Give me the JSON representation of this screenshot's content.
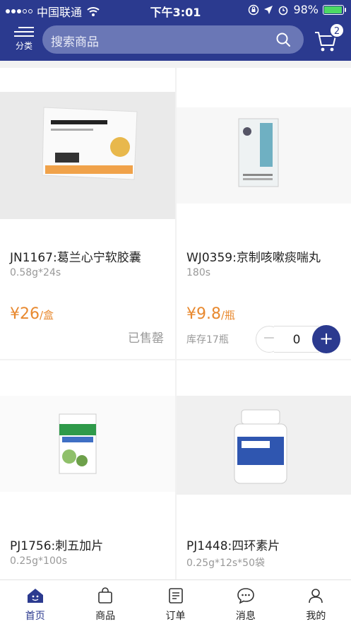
{
  "status_bar": {
    "carrier": "中国联通",
    "time": "下午3:01",
    "battery_percent": "98%",
    "battery_level": 0.98
  },
  "header": {
    "menu_label": "分类",
    "search_placeholder": "搜索商品",
    "cart_count": "2"
  },
  "products": [
    {
      "title": "JN1167:葛兰心宁软胶囊",
      "spec": "0.58g*24s",
      "price_symbol": "¥",
      "price": "26",
      "unit": "/盒",
      "status": "已售罄"
    },
    {
      "title": "WJ0359:京制咳嗽痰喘丸",
      "spec": "180s",
      "price_symbol": "¥",
      "price": "9.8",
      "unit": "/瓶",
      "stock": "库存17瓶",
      "quantity": "0"
    },
    {
      "title": "PJ1756:刺五加片",
      "spec": "0.25g*100s"
    },
    {
      "title": "PJ1448:四环素片",
      "spec": "0.25g*12s*50袋"
    }
  ],
  "tabs": [
    {
      "label": "首页",
      "icon": "home-icon",
      "active": true
    },
    {
      "label": "商品",
      "icon": "bag-icon"
    },
    {
      "label": "订单",
      "icon": "order-icon"
    },
    {
      "label": "消息",
      "icon": "message-icon"
    },
    {
      "label": "我的",
      "icon": "user-icon"
    }
  ],
  "colors": {
    "brand": "#2b3a8f",
    "price": "#e8892f",
    "muted": "#999999"
  }
}
